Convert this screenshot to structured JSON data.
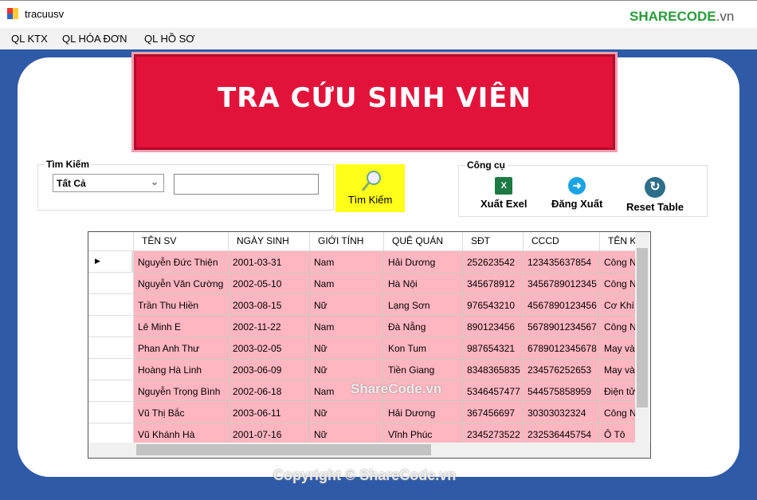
{
  "window": {
    "title": "tracuusv",
    "logo": "SHARECODE",
    "logo_suffix": ".vn"
  },
  "menu": [
    "QL KTX",
    "QL HÓA ĐƠN",
    "QL HỒ SƠ"
  ],
  "banner": "TRA CỨU SINH VIÊN",
  "search": {
    "group_label": "Tìm Kiếm",
    "filter": "Tất Cả",
    "query": "",
    "button": "Tìm Kiếm"
  },
  "tools": {
    "group_label": "Công cụ",
    "export": "Xuất Exel",
    "logout": "Đăng Xuất",
    "reset": "Reset Table"
  },
  "table": {
    "columns": [
      "TÊN SV",
      "NGÀY SINH",
      "GIỚI TÍNH",
      "QUÊ QUÁN",
      "SĐT",
      "CCCD",
      "TÊN K"
    ],
    "rows": [
      [
        "Nguyễn Đức Thiện",
        "2001-03-31",
        "Nam",
        "Hải Dương",
        "252623542",
        "123435637854",
        "Công N"
      ],
      [
        "Nguyễn Văn Cường",
        "2002-05-10",
        "Nam",
        "Hà Nội",
        "345678912",
        "3456789012345",
        "Công N"
      ],
      [
        "Trần Thu Hiền",
        "2003-08-15",
        "Nữ",
        "Lạng Sơn",
        "976543210",
        "4567890123456",
        "Cơ Khí"
      ],
      [
        "Lê Minh E",
        "2002-11-22",
        "Nam",
        "Đà Nẵng",
        "890123456",
        "5678901234567",
        "Công N"
      ],
      [
        "Phan Anh Thư",
        "2003-02-05",
        "Nữ",
        "Kon Tum",
        "987654321",
        "6789012345678",
        "May và"
      ],
      [
        "Hoàng Hà Linh",
        "2003-06-09",
        "Nữ",
        "Tiền Giang",
        "8348365835",
        "234576252653",
        "May và"
      ],
      [
        "Nguyễn Trọng Bình",
        "2002-06-18",
        "Nam",
        "",
        "5346457477",
        "544575858959",
        "Điện tử"
      ],
      [
        "Vũ Thị Bắc",
        "2003-06-11",
        "Nữ",
        "Hải Dương",
        "367456697",
        "30303032324",
        "Công N"
      ],
      [
        "Vũ Khánh Hà",
        "2001-07-16",
        "Nữ",
        "Vĩnh Phúc",
        "2345273522",
        "232536445754",
        "Ô Tô"
      ]
    ]
  },
  "watermarks": {
    "grid": "ShareCode.vn",
    "footer": "Copyright © ShareCode.vn"
  }
}
